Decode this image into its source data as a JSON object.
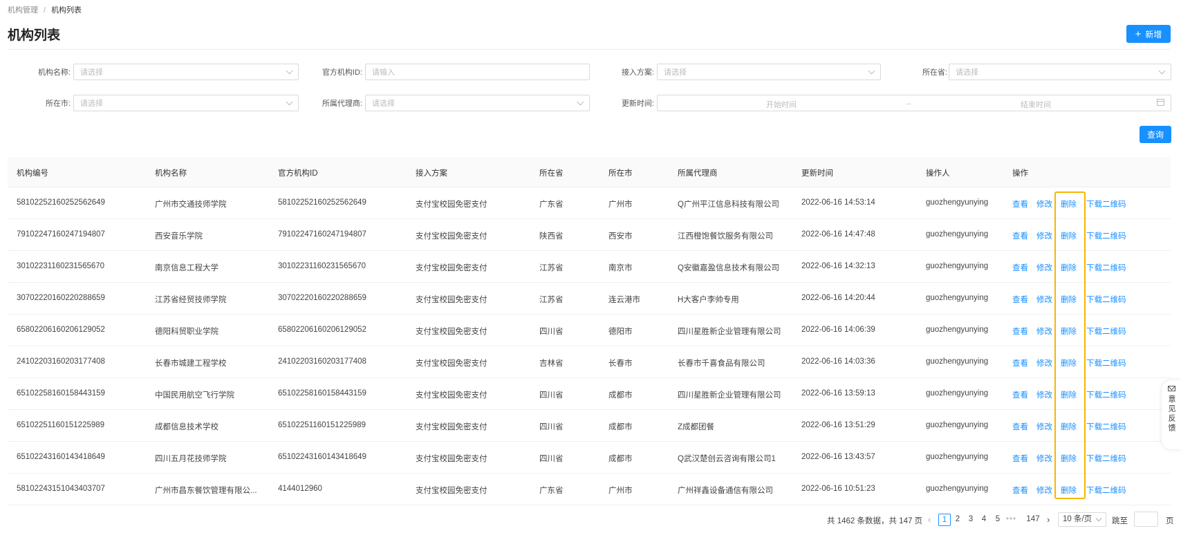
{
  "breadcrumb": {
    "parent": "机构管理",
    "separator": "/",
    "current": "机构列表"
  },
  "page_title": "机构列表",
  "add_button": {
    "icon": "plus-icon",
    "label": "新增"
  },
  "filters": {
    "org_name": {
      "label": "机构名称:",
      "placeholder": "请选择"
    },
    "official_id": {
      "label": "官方机构ID:",
      "placeholder": "请输入"
    },
    "access_plan": {
      "label": "接入方案:",
      "placeholder": "请选择"
    },
    "province": {
      "label": "所在省:",
      "placeholder": "请选择"
    },
    "city": {
      "label": "所在市:",
      "placeholder": "请选择"
    },
    "agent": {
      "label": "所属代理商:",
      "placeholder": "请选择"
    },
    "update_time": {
      "label": "更新时间:",
      "start": "开始时间",
      "arrow": "→",
      "end": "结束时间"
    }
  },
  "query_button": "查询",
  "table": {
    "columns": [
      "机构编号",
      "机构名称",
      "官方机构ID",
      "接入方案",
      "所在省",
      "所在市",
      "所属代理商",
      "更新时间",
      "操作人",
      "操作"
    ],
    "actions": {
      "view": "查看",
      "edit": "修改",
      "delete": "删除",
      "download": "下载二维码"
    },
    "rows": [
      [
        "58102252160252562649",
        "广州市交通技师学院",
        "58102252160252562649",
        "支付宝校园免密支付",
        "广东省",
        "广州市",
        "Q广州平江信息科技有限公司",
        "2022-06-16 14:53:14",
        "guozhengyunying"
      ],
      [
        "79102247160247194807",
        "西安音乐学院",
        "79102247160247194807",
        "支付宝校园免密支付",
        "陕西省",
        "西安市",
        "江西橙饱餐饮服务有限公司",
        "2022-06-16 14:47:48",
        "guozhengyunying"
      ],
      [
        "30102231160231565670",
        "南京信息工程大学",
        "30102231160231565670",
        "支付宝校园免密支付",
        "江苏省",
        "南京市",
        "Q安徽嘉盈信息技术有限公司",
        "2022-06-16 14:32:13",
        "guozhengyunying"
      ],
      [
        "30702220160220288659",
        "江苏省经贸技师学院",
        "30702220160220288659",
        "支付宝校园免密支付",
        "江苏省",
        "连云港市",
        "H大客户李帅专用",
        "2022-06-16 14:20:44",
        "guozhengyunying"
      ],
      [
        "65802206160206129052",
        "德阳科贸职业学院",
        "65802206160206129052",
        "支付宝校园免密支付",
        "四川省",
        "德阳市",
        "四川星胜新企业管理有限公司",
        "2022-06-16 14:06:39",
        "guozhengyunying"
      ],
      [
        "24102203160203177408",
        "长春市城建工程学校",
        "24102203160203177408",
        "支付宝校园免密支付",
        "吉林省",
        "长春市",
        "长春市千喜食品有限公司",
        "2022-06-16 14:03:36",
        "guozhengyunying"
      ],
      [
        "65102258160158443159",
        "中国民用航空飞行学院",
        "65102258160158443159",
        "支付宝校园免密支付",
        "四川省",
        "成都市",
        "四川星胜新企业管理有限公司",
        "2022-06-16 13:59:13",
        "guozhengyunying"
      ],
      [
        "65102251160151225989",
        "成都信息技术学校",
        "65102251160151225989",
        "支付宝校园免密支付",
        "四川省",
        "成都市",
        "Z成都团餐",
        "2022-06-16 13:51:29",
        "guozhengyunying"
      ],
      [
        "65102243160143418649",
        "四川五月花技师学院",
        "65102243160143418649",
        "支付宝校园免密支付",
        "四川省",
        "成都市",
        "Q武汉楚创云咨询有限公司1",
        "2022-06-16 13:43:57",
        "guozhengyunying"
      ],
      [
        "58102243151043403707",
        "广州市昌东餐饮管理有限公...",
        "4144012960",
        "支付宝校园免密支付",
        "广东省",
        "广州市",
        "广州祥鑫设备通信有限公司",
        "2022-06-16 10:51:23",
        "guozhengyunying"
      ]
    ]
  },
  "pagination": {
    "total": "共 1462 条数据，共 147 页",
    "pages": [
      "1",
      "2",
      "3",
      "4",
      "5"
    ],
    "ellipsis": "•••",
    "last": "147",
    "page_size": "10 条/页",
    "jump_label": "跳至",
    "jump_unit": "页"
  },
  "feedback": {
    "icon": "mail-icon",
    "label": "意见反馈"
  },
  "highlight_color": "#f7b500",
  "accent_color": "#1890ff"
}
